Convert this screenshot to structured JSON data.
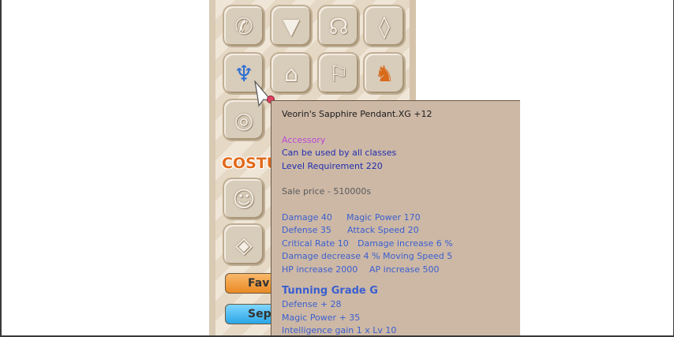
{
  "panel": {
    "costume_label": "COSTU",
    "slots": [
      {
        "name": "shoes-slot",
        "icon": "✆"
      },
      {
        "name": "shirt-slot",
        "icon": "👕"
      },
      {
        "name": "glove-slot",
        "icon": "☊"
      },
      {
        "name": "ring2-slot",
        "icon": "⌘"
      },
      {
        "name": "necklace-slot",
        "icon": "♆"
      },
      {
        "name": "pants-slot",
        "icon": "⌂"
      },
      {
        "name": "pet-tag-slot",
        "icon": "⚐"
      },
      {
        "name": "pet-slot",
        "icon": "🐕"
      },
      {
        "name": "ring-slot",
        "icon": "◎"
      },
      {
        "name": "costume-head-slot",
        "icon": "☺"
      },
      {
        "name": "costume-body-slot",
        "icon": "◈"
      }
    ],
    "fav_label": "Fav",
    "sep_label": "Sep"
  },
  "tooltip": {
    "item_name": "Veorin's Sapphire Pendant.XG +12",
    "item_type": "Accessory",
    "class_req": "Can be used by all classes",
    "level_req": "Level Requirement 220",
    "sale_price": "Sale price - 510000s",
    "stats": [
      [
        "Damage 40",
        "Magic Power 170"
      ],
      [
        "Defense 35",
        "Attack Speed 20"
      ],
      [
        "Critical Rate 10",
        "Damage increase 6 %"
      ],
      [
        "Damage decrease 4 %",
        "Moving Speed 5"
      ],
      [
        "HP increase 2000",
        "AP increase 500"
      ]
    ],
    "grade_title": "Tunning Grade G",
    "grade_stats": [
      "Defense + 28",
      "Magic Power + 35",
      "Intelligence gain 1 x Lv 10"
    ]
  },
  "colors": {
    "tooltip_bg": "#cdb8a6",
    "type_color": "#b84ad6",
    "req_color": "#1f2db0",
    "stat_color": "#3a5fcf",
    "costume_color": "#e26b1c"
  }
}
